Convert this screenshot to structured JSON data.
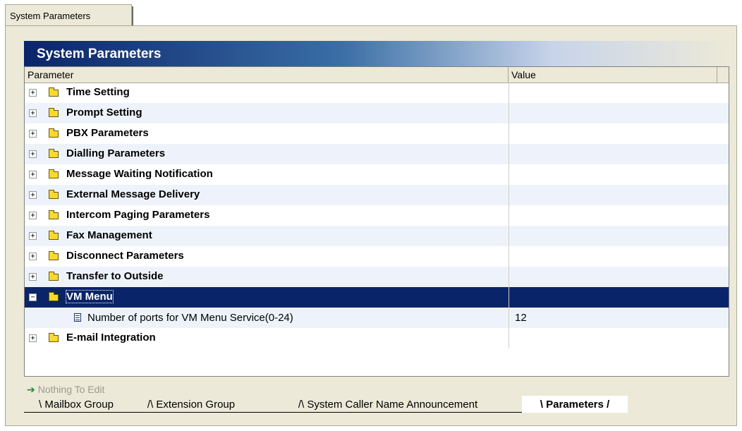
{
  "top_tab": {
    "label": "System Parameters"
  },
  "header": {
    "title": "System Parameters"
  },
  "columns": {
    "parameter": "Parameter",
    "value": "Value"
  },
  "rows": [
    {
      "label": "Time Setting",
      "expander": "+"
    },
    {
      "label": "Prompt Setting",
      "expander": "+"
    },
    {
      "label": "PBX Parameters",
      "expander": "+"
    },
    {
      "label": "Dialling Parameters",
      "expander": "+"
    },
    {
      "label": "Message Waiting Notification",
      "expander": "+"
    },
    {
      "label": "External Message Delivery",
      "expander": "+"
    },
    {
      "label": "Intercom Paging Parameters",
      "expander": "+"
    },
    {
      "label": "Fax Management",
      "expander": "+"
    },
    {
      "label": "Disconnect Parameters",
      "expander": "+"
    },
    {
      "label": "Transfer to Outside",
      "expander": "+"
    },
    {
      "label": "VM Menu",
      "expander": "−",
      "selected": true
    },
    {
      "label": "E-mail Integration",
      "expander": "+"
    }
  ],
  "child_row": {
    "label": "Number of ports for VM Menu Service(0-24)",
    "value": "12"
  },
  "status": {
    "text": "Nothing To Edit"
  },
  "bottom_tabs": [
    {
      "label": "Mailbox Group"
    },
    {
      "label": "Extension Group"
    },
    {
      "label": "System Caller Name Announcement"
    },
    {
      "label": "Parameters",
      "active": true
    }
  ],
  "colors": {
    "selection": "#0a246a",
    "panel": "#ece9d8",
    "folder": "#f8d930",
    "alt_row": "#eef3fb"
  }
}
